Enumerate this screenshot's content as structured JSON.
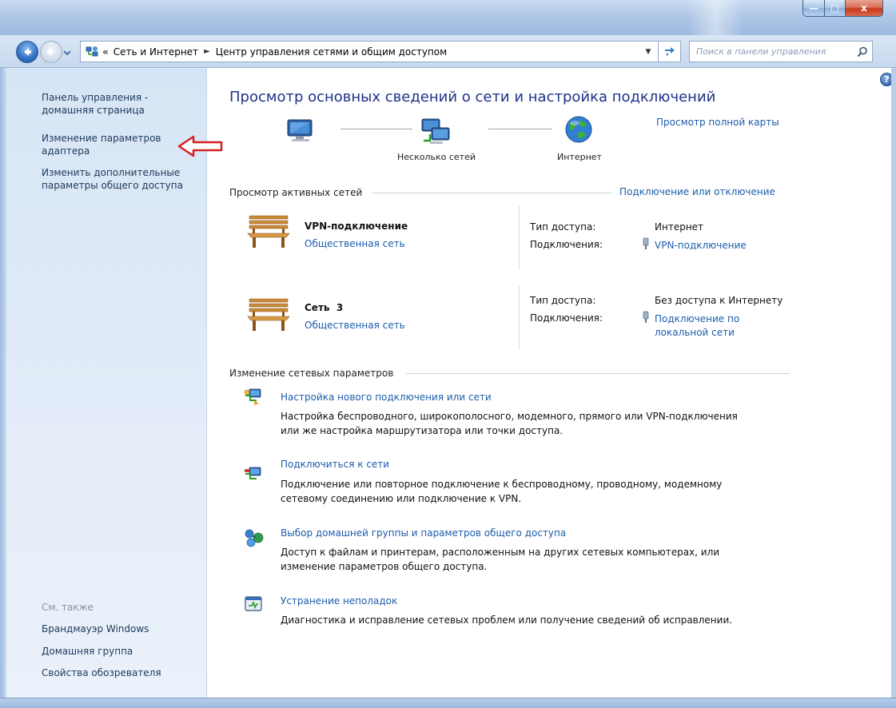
{
  "window": {
    "minimize_label": "—",
    "maximize_label": "□",
    "close_label": "x"
  },
  "addressbar": {
    "overflow_label": "«",
    "breadcrumb": [
      "Сеть и Интернет",
      "Центр управления сетями и общим доступом"
    ],
    "separator": "►",
    "search_placeholder": "Поиск в панели управления"
  },
  "sidebar": {
    "links": [
      "Панель управления - домашняя страница",
      "Изменение параметров адаптера",
      "Изменить дополнительные параметры общего доступа"
    ],
    "see_also_label": "См. также",
    "see_also_links": [
      "Брандмауэр Windows",
      "Домашняя группа",
      "Свойства обозревателя"
    ]
  },
  "main": {
    "title": "Просмотр основных сведений о сети и настройка подключений",
    "network_map": {
      "full_map_link": "Просмотр полной карты",
      "middle_label": "Несколько сетей",
      "right_label": "Интернет"
    },
    "active_networks": {
      "heading": "Просмотр активных сетей",
      "connect_link": "Подключение или отключение",
      "networks": [
        {
          "name": "VPN-подключение",
          "type": "Общественная сеть",
          "access_type_label": "Тип доступа:",
          "access_type": "Интернет",
          "connections_label": "Подключения:",
          "connection": "VPN-подключение"
        },
        {
          "name": "Сеть  3",
          "type": "Общественная сеть",
          "access_type_label": "Тип доступа:",
          "access_type": "Без доступа к Интернету",
          "connections_label": "Подключения:",
          "connection_line1": "Подключение по",
          "connection_line2": "локальной сети"
        }
      ]
    },
    "change_settings": {
      "heading": "Изменение сетевых параметров",
      "tasks": [
        {
          "title": "Настройка нового подключения или сети",
          "desc1": "Настройка беспроводного, широкополосного, модемного, прямого или VPN-подключения",
          "desc2": "или же настройка маршрутизатора или точки доступа."
        },
        {
          "title": "Подключиться к сети",
          "desc1": "Подключение или повторное подключение к беспроводному, проводному, модемному",
          "desc2": "сетевому соединению или подключение к VPN."
        },
        {
          "title": "Выбор домашней группы и параметров общего доступа",
          "desc1": "Доступ к файлам и принтерам, расположенным на других сетевых компьютерах, или",
          "desc2": "изменение параметров общего доступа."
        },
        {
          "title": "Устранение неполадок",
          "desc1": "Диагностика и исправление сетевых проблем или получение сведений об исправлении."
        }
      ]
    },
    "help_label": "?"
  },
  "colors": {
    "link": "#1c5cac",
    "title": "#1e3287",
    "sidebar_bg": "#d6e5f5",
    "annotation_arrow": "#d62020"
  }
}
